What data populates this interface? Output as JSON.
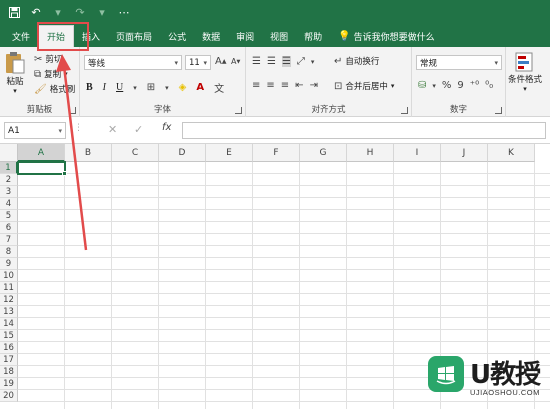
{
  "quick_access": {
    "save_icon": "save-icon",
    "undo_icon": "undo-icon",
    "redo_icon": "redo-icon"
  },
  "tabs": [
    {
      "label": "文件",
      "active": false
    },
    {
      "label": "开始",
      "active": true
    },
    {
      "label": "插入",
      "active": false
    },
    {
      "label": "页面布局",
      "active": false
    },
    {
      "label": "公式",
      "active": false
    },
    {
      "label": "数据",
      "active": false
    },
    {
      "label": "审阅",
      "active": false
    },
    {
      "label": "视图",
      "active": false
    },
    {
      "label": "帮助",
      "active": false
    }
  ],
  "tell_me": "告诉我你想要做什么",
  "clipboard": {
    "paste": "粘贴",
    "cut": "剪切",
    "copy": "复制",
    "format_painter": "格式刷",
    "group": "剪贴板"
  },
  "font": {
    "name": "等线",
    "size": "11",
    "group": "字体",
    "bold": "B",
    "italic": "I",
    "underline": "U"
  },
  "alignment": {
    "wrap": "自动换行",
    "merge": "合并后居中",
    "group": "对齐方式"
  },
  "number": {
    "format": "常规",
    "percent": "%",
    "comma": "9",
    "group": "数字"
  },
  "styles": {
    "conditional": "条件格式"
  },
  "formula_bar": {
    "name_box": "A1",
    "fx": "fx",
    "cancel": "✕",
    "enter": "✓"
  },
  "grid": {
    "columns": [
      "A",
      "B",
      "C",
      "D",
      "E",
      "F",
      "G",
      "H",
      "I",
      "J",
      "K"
    ],
    "rows": [
      "1",
      "2",
      "3",
      "4",
      "5",
      "6",
      "7",
      "8",
      "9",
      "10",
      "11",
      "12",
      "13",
      "14",
      "15",
      "16",
      "17",
      "18",
      "19",
      "20"
    ],
    "active_cell": "A1"
  },
  "watermark": {
    "brand": "U教授",
    "url": "UJIAOSHOU.COM"
  },
  "colors": {
    "accent": "#217346",
    "annotation": "#e24b4b"
  }
}
